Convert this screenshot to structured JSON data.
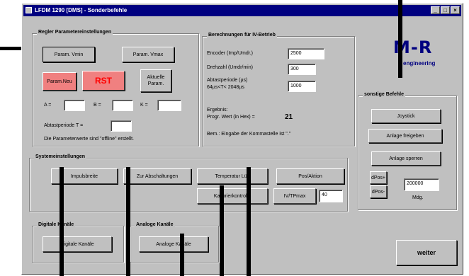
{
  "window": {
    "title": "LFDM 1290 [DMS] - Sonderbefehle"
  },
  "titlebar_buttons": [
    "_",
    "□",
    "×"
  ],
  "regler": {
    "label": "Regler Parametereinstellungen",
    "param_vmin": "Param. Vmin",
    "param_vmax": "Param. Vmax",
    "param_neu": "Param.Neu",
    "rst": "RST",
    "aktuelle_param": "Aktuelle Param.",
    "a_label": "A =",
    "b_label": "B =",
    "k_label": "K =",
    "abtastperiode_label": "Abtastperiode T =",
    "note": "Die Parameterwerte sind \"offline\" erstellt."
  },
  "berechnungen": {
    "label": "Berechnungen für IV-Betrieb",
    "encoder_label": "Encoder (Imp/Umdr.)",
    "encoder_value": "2500",
    "drehzahl_label": "Drehzahl (Umdr/min)",
    "drehzahl_value": "300",
    "abtast_label": "Abtastperiode (µs)",
    "abtast_sub": "64µs<T< 2048µs",
    "abtast_value": "1000",
    "ergebnis_label": "Ergebnis:",
    "progr_label": "Progr. Wert (in Hex) =",
    "progr_value": "21",
    "bem": "Bem.: Eingabe der Kommastelle ist \".\""
  },
  "logo": {
    "text": "M-R",
    "sub": "engineering"
  },
  "sonstige": {
    "label": "sonstige Befehle",
    "joystick": "Joystick",
    "anlage_freigeben": "Anlage freigeben",
    "anlage_sperren": "Anlage sperren",
    "dpos_plus": "dPos+",
    "dpos_minus": "dPos-",
    "dpos_value": "200000",
    "unit": "Mdg."
  },
  "system": {
    "label": "Systemeinstellungen",
    "btn1": "Impulsbreite",
    "btn2": "Zur Abschaltungen",
    "btn3": "Temperatur Lüft",
    "btn4": "Pos/Aktion",
    "btn5": "Kalibrierkontrolle",
    "btn6": "IV/TPmax",
    "iv_value": "40"
  },
  "digital": {
    "label": "Digitale Kanäle",
    "button": "Digitale Kanäle"
  },
  "analog": {
    "label": "Analoge Kanäle",
    "button": "Analoge Kanäle"
  },
  "weiter": "weiter"
}
